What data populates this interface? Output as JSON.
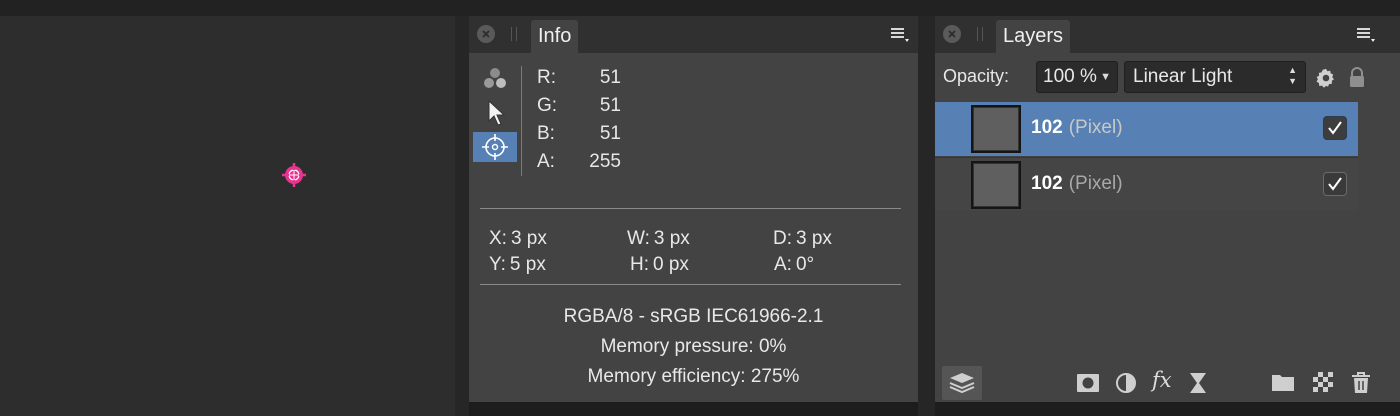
{
  "info_panel": {
    "tab_label": "Info",
    "rgba": [
      {
        "key": "R:",
        "value": "51"
      },
      {
        "key": "G:",
        "value": "51"
      },
      {
        "key": "B:",
        "value": "51"
      },
      {
        "key": "A:",
        "value": "255"
      }
    ],
    "metrics": {
      "x": {
        "key": "X:",
        "value": "3 px"
      },
      "y": {
        "key": "Y:",
        "value": "5 px"
      },
      "w": {
        "key": "W:",
        "value": "3 px"
      },
      "h": {
        "key": "H:",
        "value": "0 px"
      },
      "d": {
        "key": "D:",
        "value": "3 px"
      },
      "a": {
        "key": "A:",
        "value": "0°"
      }
    },
    "color_profile": "RGBA/8 - sRGB IEC61966-2.1",
    "memory_pressure": "Memory pressure: 0%",
    "memory_efficiency": "Memory efficiency: 275%",
    "tools": [
      "color-channels-icon",
      "pointer-icon",
      "crosshair-icon"
    ]
  },
  "layers_panel": {
    "tab_label": "Layers",
    "opacity_label": "Opacity:",
    "opacity_value": "100 %",
    "blend_mode": "Linear Light",
    "layers": [
      {
        "name": "102",
        "type": "(Pixel)",
        "selected": true,
        "visible": true
      },
      {
        "name": "102",
        "type": "(Pixel)",
        "selected": false,
        "visible": true
      }
    ]
  },
  "colors": {
    "accent": "#5781b5",
    "panel_bg": "#434343",
    "canvas_bg": "#2d2d2d",
    "target_marker": "#e8338f"
  }
}
